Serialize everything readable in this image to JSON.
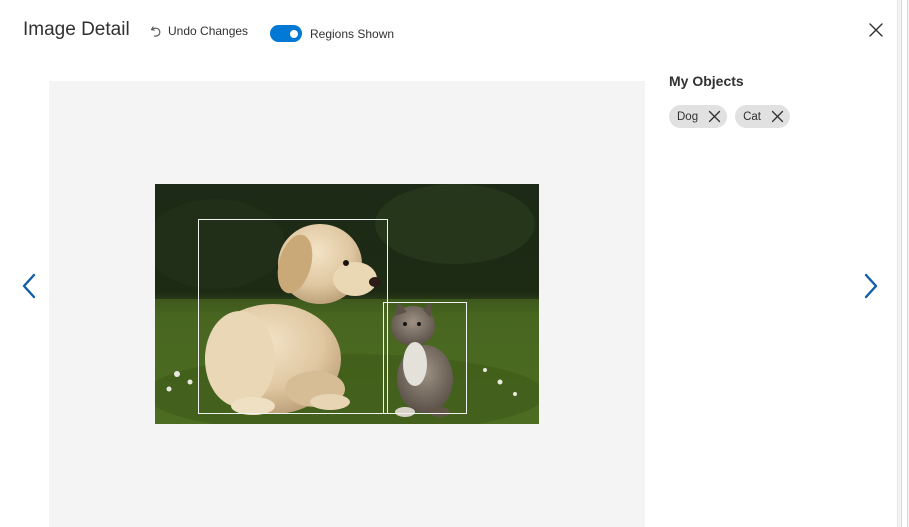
{
  "header": {
    "title": "Image Detail",
    "undo_label": "Undo Changes",
    "toggle_label": "Regions Shown",
    "toggle_on": true
  },
  "sidebar": {
    "title": "My Objects",
    "tags": [
      {
        "label": "Dog"
      },
      {
        "label": "Cat"
      }
    ]
  },
  "icons": {
    "undo": "undo-icon",
    "close": "close-icon",
    "prev": "chevron-left-icon",
    "next": "chevron-right-icon",
    "tag_remove": "close-icon"
  },
  "colors": {
    "accent": "#0078d4",
    "chevron": "#0f5ea8",
    "tag_bg": "#e1e1e1",
    "canvas_bg": "#f4f4f4"
  }
}
